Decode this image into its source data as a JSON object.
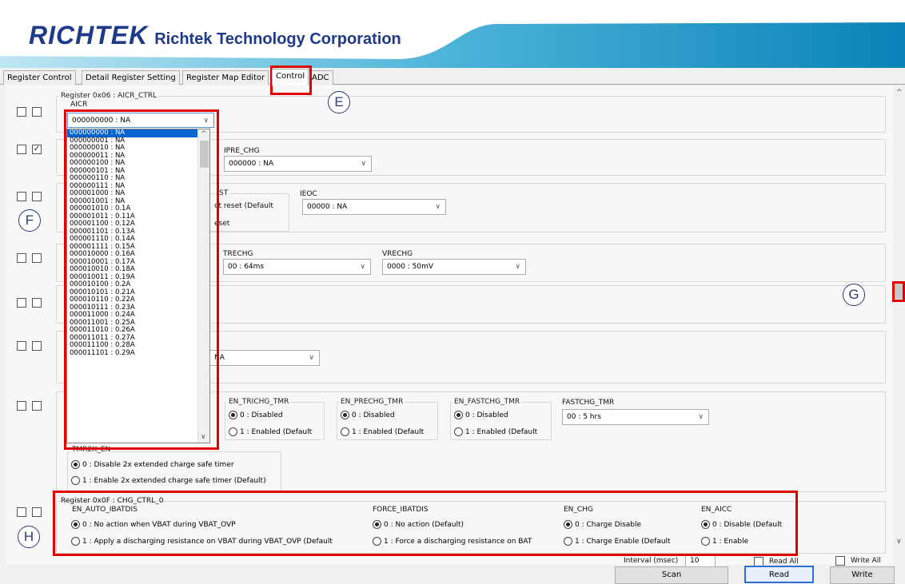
{
  "header": {
    "brand": "RICHTEK",
    "corp": "Richtek Technology Corporation"
  },
  "tabs": [
    "Register Control",
    "Detail Register Setting",
    "Register Map Editor",
    "Control",
    "ADC"
  ],
  "markers": {
    "e": "E",
    "f": "F",
    "g": "G",
    "h": "H"
  },
  "reg06": {
    "title": "Register 0x06 : AICR_CTRL",
    "field": "AICR",
    "selected": "000000000 : NA",
    "options": [
      "000000000 : NA",
      "000000001 : NA",
      "000000010 : NA",
      "000000011 : NA",
      "000000100 : NA",
      "000000101 : NA",
      "000000110 : NA",
      "000000111 : NA",
      "000001000 : NA",
      "000001001 : NA",
      "000001010 : 0.1A",
      "000001011 : 0.11A",
      "000001100 : 0.12A",
      "000001101 : 0.13A",
      "000001110 : 0.14A",
      "000001111 : 0.15A",
      "000010000 : 0.16A",
      "000010001 : 0.17A",
      "000010010 : 0.18A",
      "000010011 : 0.19A",
      "000010100 : 0.2A",
      "000010101 : 0.21A",
      "000010110 : 0.22A",
      "000010111 : 0.23A",
      "000011000 : 0.24A",
      "000011001 : 0.25A",
      "000011010 : 0.26A",
      "000011011 : 0.27A",
      "000011100 : 0.28A",
      "000011101 : 0.29A"
    ]
  },
  "ipre": {
    "label": "IPRE_CHG",
    "value": "000000 : NA"
  },
  "rstgrp": {
    "label_frag": "ST",
    "opt0": "ot reset (Default",
    "opt1": "eset"
  },
  "ieoc": {
    "label": "IEOC",
    "value": "00000 : NA"
  },
  "trechg": {
    "label": "TRECHG",
    "value": "00 : 64ms"
  },
  "vrechg": {
    "label": "VRECHG",
    "value": "0000 : 50mV"
  },
  "partialsel": {
    "value": "NA"
  },
  "timer": {
    "en_trichg": {
      "label": "EN_TRICHG_TMR",
      "opt0": "0 : Disabled",
      "opt1": "1 : Enabled (Default"
    },
    "en_prechg": {
      "label": "EN_PRECHG_TMR",
      "opt0": "0 : Disabled",
      "opt1": "1 : Enabled (Default"
    },
    "en_fastchg": {
      "label": "EN_FASTCHG_TMR",
      "opt0": "0 : Disabled",
      "opt1": "1 : Enabled (Default"
    },
    "fastchg_tmr": {
      "label": "FASTCHG_TMR",
      "value": "00 : 5 hrs"
    },
    "tmr2x": {
      "label": "TMR2X_EN",
      "opt0": "0 : Disable 2x extended charge safe timer",
      "opt1": "1 : Enable 2x extended charge safe timer (Default)"
    }
  },
  "reg0f": {
    "title": "Register 0x0F : CHG_CTRL_0",
    "auto_ibatdis": {
      "label": "EN_AUTO_IBATDIS",
      "opt0": "0 : No action when VBAT during VBAT_OVP",
      "opt1": "1 : Apply a discharging resistance on VBAT during VBAT_OVP (Default"
    },
    "force_ibatdis": {
      "label": "FORCE_IBATDIS",
      "opt0": "0 : No action (Default)",
      "opt1": "1 : Force a discharging resistance on BAT"
    },
    "en_chg": {
      "label": "EN_CHG",
      "opt0": "0 : Charge Disable",
      "opt1": "1 : Charge Enable (Default"
    },
    "en_aicc": {
      "label": "EN_AICC",
      "opt0": "0 : Disable (Default",
      "opt1": "1 : Enable"
    }
  },
  "bottom": {
    "interval_label": "Interval (msec)",
    "interval_value": "10",
    "read_all": "Read All",
    "write_all": "Write All",
    "scan": "Scan",
    "read": "Read",
    "write": "Write"
  },
  "icons": {
    "check": "✓",
    "chev": "∨",
    "up": "^"
  },
  "colors": {
    "brand": "#1e3a8a",
    "highlight": "#0a64d0",
    "annotation": "#e00000"
  }
}
